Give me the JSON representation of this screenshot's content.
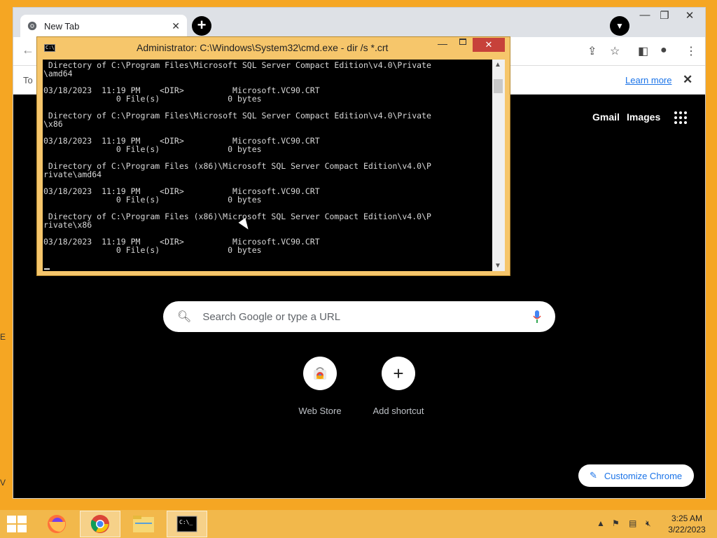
{
  "desktop": {
    "edge_letters": [
      "E",
      "V"
    ]
  },
  "chrome": {
    "tab_title": "New Tab",
    "infobar_text": "To",
    "learn_more": "Learn more",
    "ntp_links": {
      "gmail": "Gmail",
      "images": "Images"
    },
    "search_placeholder": "Search Google or type a URL",
    "shortcuts": [
      {
        "label": "Web Store"
      },
      {
        "label": "Add shortcut"
      }
    ],
    "customize_label": "Customize Chrome"
  },
  "cmd": {
    "title": "Administrator: C:\\Windows\\System32\\cmd.exe - dir  /s *.crt",
    "lines": [
      " Directory of C:\\Program Files\\Microsoft SQL Server Compact Edition\\v4.0\\Private",
      "\\amd64",
      "",
      "03/18/2023  11:19 PM    <DIR>          Microsoft.VC90.CRT",
      "               0 File(s)              0 bytes",
      "",
      " Directory of C:\\Program Files\\Microsoft SQL Server Compact Edition\\v4.0\\Private",
      "\\x86",
      "",
      "03/18/2023  11:19 PM    <DIR>          Microsoft.VC90.CRT",
      "               0 File(s)              0 bytes",
      "",
      " Directory of C:\\Program Files (x86)\\Microsoft SQL Server Compact Edition\\v4.0\\P",
      "rivate\\amd64",
      "",
      "03/18/2023  11:19 PM    <DIR>          Microsoft.VC90.CRT",
      "               0 File(s)              0 bytes",
      "",
      " Directory of C:\\Program Files (x86)\\Microsoft SQL Server Compact Edition\\v4.0\\P",
      "rivate\\x86",
      "",
      "03/18/2023  11:19 PM    <DIR>          Microsoft.VC90.CRT",
      "               0 File(s)              0 bytes"
    ]
  },
  "taskbar": {
    "time": "3:25 AM",
    "date": "3/22/2023"
  },
  "colors": {
    "desktop": "#f5a623",
    "taskbar": "#f2b84b",
    "cmd_frame": "#f6c66b",
    "link_blue": "#1a73e8"
  }
}
